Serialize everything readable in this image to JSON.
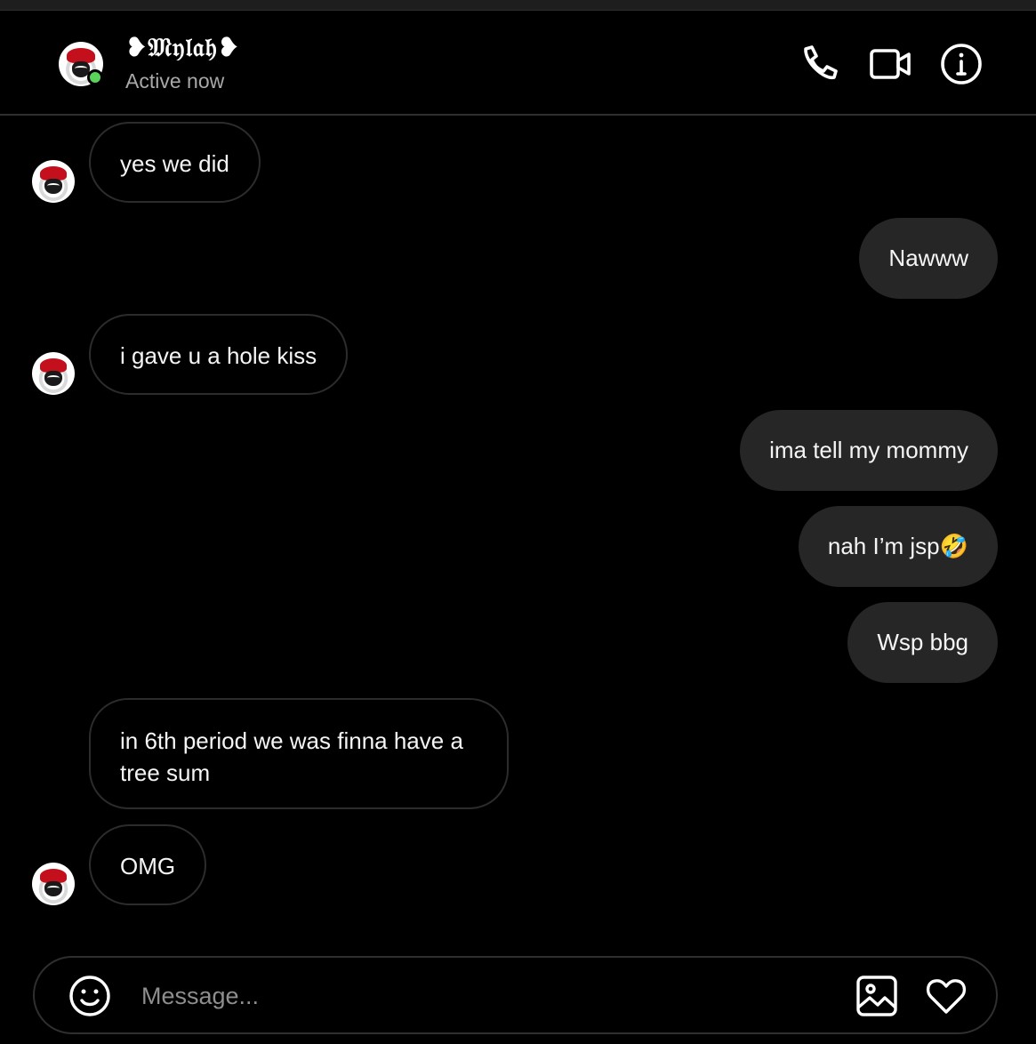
{
  "header": {
    "name": "❥𝔐𝔶𝔩𝔞𝔥❥",
    "status": "Active now",
    "icons": [
      "phone-icon",
      "video-camera-icon",
      "info-icon"
    ]
  },
  "messages": [
    {
      "direction": "incoming",
      "text": "yes we did",
      "avatar": true
    },
    {
      "direction": "outgoing",
      "text": "Nawww"
    },
    {
      "direction": "incoming",
      "text": "i gave u a hole kiss",
      "avatar": true
    },
    {
      "direction": "outgoing",
      "text": "ima tell my mommy"
    },
    {
      "direction": "outgoing",
      "text": "nah I’m jsp🤣"
    },
    {
      "direction": "outgoing",
      "text": "Wsp bbg"
    },
    {
      "direction": "incoming",
      "text": "in 6th period we was finna have a tree sum",
      "avatar": false
    },
    {
      "direction": "incoming",
      "text": "OMG",
      "avatar": true
    }
  ],
  "composer": {
    "placeholder": "Message...",
    "value": "",
    "icons": [
      "emoji-icon",
      "image-icon",
      "heart-icon"
    ]
  },
  "colors": {
    "background": "#000000",
    "outgoing_bubble": "#262626",
    "incoming_border": "#2c2c2c",
    "online": "#5ad35a",
    "secondary_text": "#a8a8a8"
  }
}
